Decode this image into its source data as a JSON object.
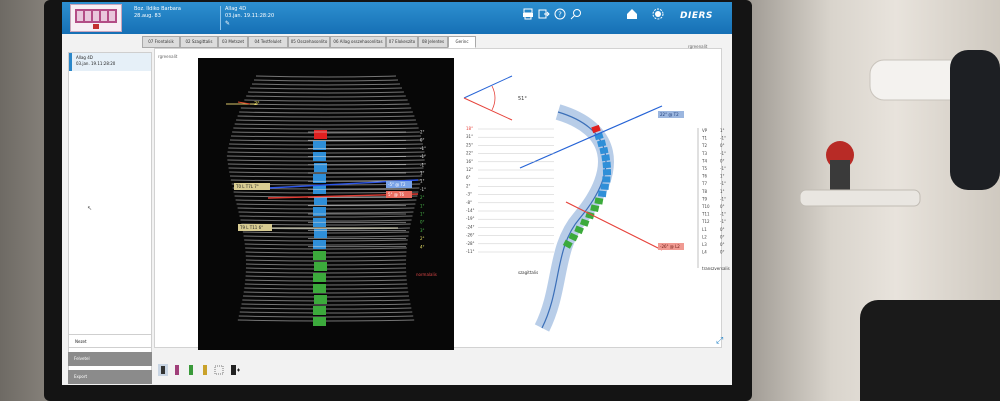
{
  "header": {
    "patient_name": "Boz. Ildiko Barbara",
    "patient_dob": "28.aug. 83",
    "exam_title": "Allag 4D",
    "exam_date": "03.jan. 19.11:28:20",
    "brand": "DIERS"
  },
  "tabs": [
    {
      "label": "07 Frontalsik",
      "active": false
    },
    {
      "label": "02 Szagittalis",
      "active": false
    },
    {
      "label": "03 Metszet",
      "active": false
    },
    {
      "label": "04 Testfelulet",
      "active": false
    },
    {
      "label": "05 Osszehasonlito",
      "active": false
    },
    {
      "label": "06 Allag osszehasonlitas",
      "active": false
    },
    {
      "label": "07 Elokeszito",
      "active": false
    },
    {
      "label": "08 Jelentes",
      "active": false
    },
    {
      "label": "Gerinc",
      "active": true
    }
  ],
  "sidebar": {
    "item_title": "Allag 4D",
    "item_date": "03.jan. 19.11:28:20",
    "buttons": [
      "Nezet",
      "Felvetel",
      "Export"
    ]
  },
  "content": {
    "left_view_label": "rgreenalit",
    "right_view_label": "rgreenalit",
    "angle_left": "2°",
    "angle_right": "51°",
    "left_labels": [
      {
        "text": "T0 L T7L 7°"
      },
      {
        "text": "T9 L T11 6°"
      }
    ],
    "left_values": [
      "2°",
      "0°",
      "-1°",
      "-1°",
      "-1°",
      "1°",
      "1°",
      "-1°",
      "2°",
      "1°",
      "1°",
      "0°",
      "3°",
      "2°",
      "4°"
    ],
    "left_boxes": [
      "-5° @ T2",
      "5° @ T6"
    ],
    "left_footer": "normalalis",
    "sagittal_values": [
      "18°",
      "31°",
      "25°",
      "22°",
      "16°",
      "12°",
      "6°",
      "2°",
      "-3°",
      "-8°",
      "-14°",
      "-19°",
      "-24°",
      "-26°",
      "-28°",
      "-11°"
    ],
    "sagittal_tags": [
      "22° @ T2",
      "-26° @ L2"
    ],
    "sagittal_footer": "szagittalis",
    "right_table": [
      {
        "label": "VP",
        "value": "1°"
      },
      {
        "label": "T1",
        "value": "-1°"
      },
      {
        "label": "T2",
        "value": "0°"
      },
      {
        "label": "T3",
        "value": "-1°"
      },
      {
        "label": "T4",
        "value": "0°"
      },
      {
        "label": "T5",
        "value": "-1°"
      },
      {
        "label": "T6",
        "value": "1°"
      },
      {
        "label": "T7",
        "value": "-1°"
      },
      {
        "label": "T8",
        "value": "1°"
      },
      {
        "label": "T9",
        "value": "-1°"
      },
      {
        "label": "T10",
        "value": "0°"
      },
      {
        "label": "T11",
        "value": "-1°"
      },
      {
        "label": "T12",
        "value": "-1°"
      },
      {
        "label": "L1",
        "value": "0°"
      },
      {
        "label": "L2",
        "value": "0°"
      },
      {
        "label": "L3",
        "value": "0°"
      },
      {
        "label": "L4",
        "value": "0°"
      }
    ],
    "right_footer": "transzversalis"
  },
  "colors": {
    "header_blue": "#1670b5",
    "vertebra_red": "#e02020",
    "vertebra_blue": "#2f8fd8",
    "vertebra_green": "#3caa3c",
    "measure_red": "#e6423a",
    "measure_blue": "#2563d6"
  },
  "icons": [
    "print-icon",
    "export-icon",
    "help-icon",
    "search-icon",
    "home-icon",
    "settings-icon",
    "expand-icon"
  ]
}
